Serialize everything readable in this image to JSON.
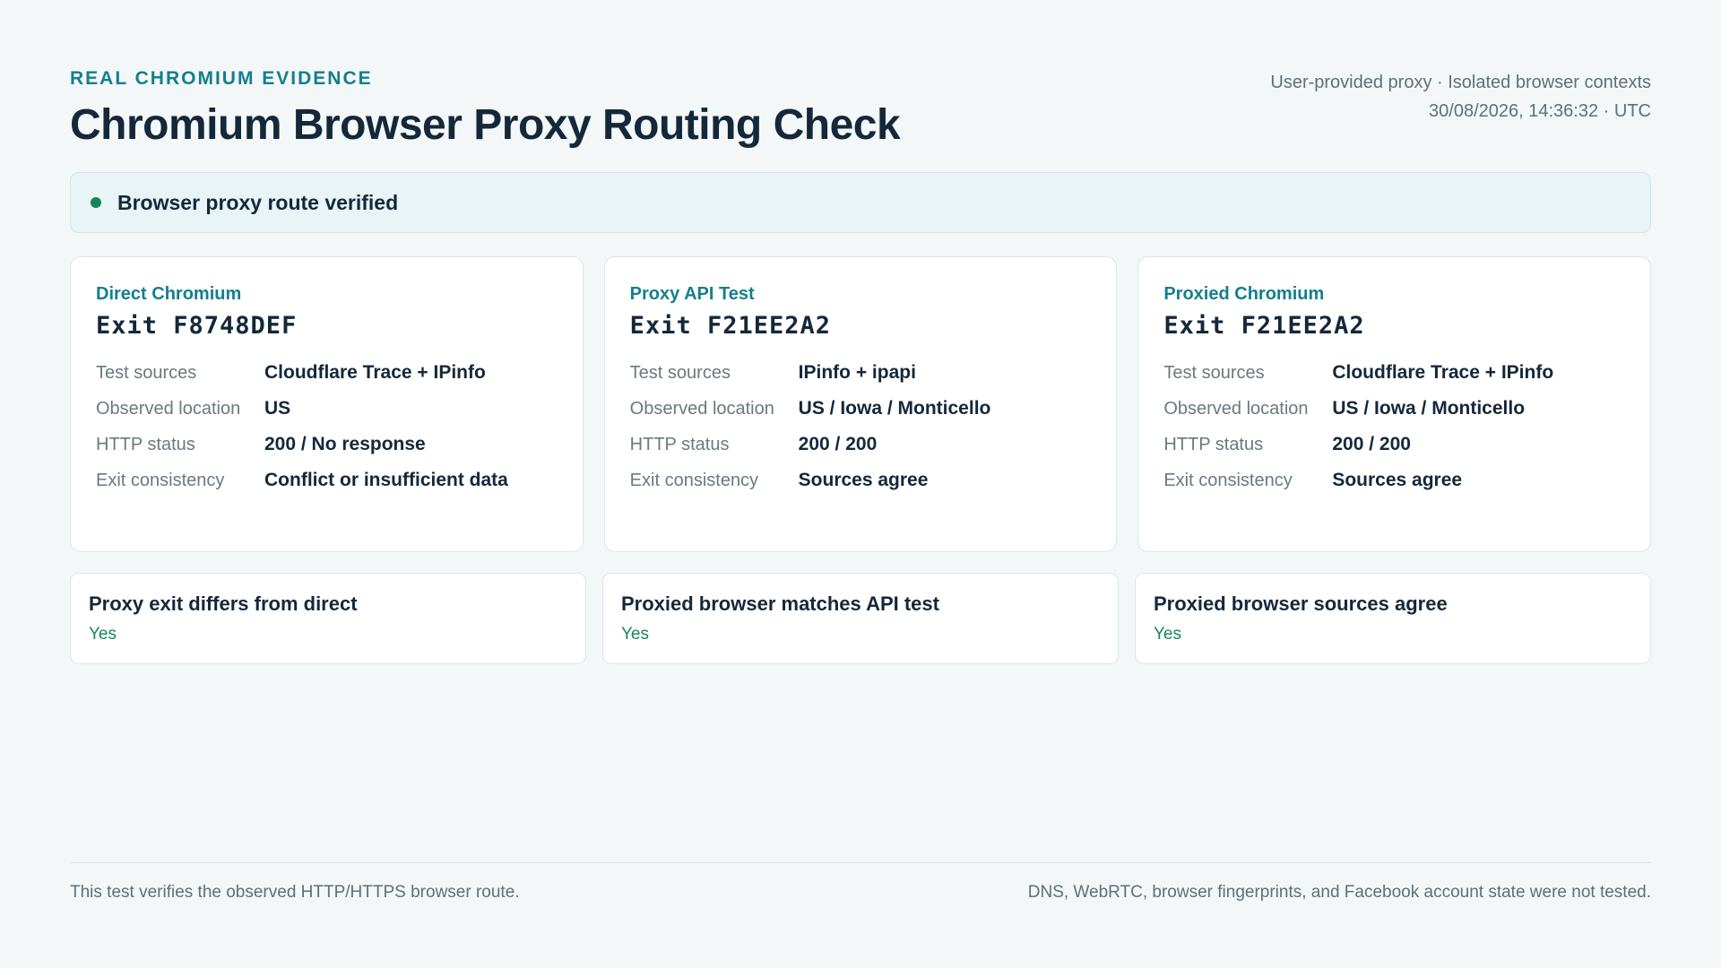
{
  "header": {
    "eyebrow": "REAL CHROMIUM EVIDENCE",
    "title": "Chromium Browser Proxy Routing Check",
    "meta_line1": "User-provided proxy · Isolated browser contexts",
    "meta_line2": "30/08/2026, 14:36:32 · UTC"
  },
  "banner": {
    "status_text": "Browser proxy route verified",
    "status_color": "#17855c"
  },
  "cards": [
    {
      "label": "Direct Chromium",
      "exit": "Exit F8748DEF",
      "rows": [
        {
          "key": "Test sources",
          "value": "Cloudflare Trace + IPinfo"
        },
        {
          "key": "Observed location",
          "value": "US"
        },
        {
          "key": "HTTP status",
          "value": "200 / No response"
        },
        {
          "key": "Exit consistency",
          "value": "Conflict or insufficient data"
        }
      ]
    },
    {
      "label": "Proxy API Test",
      "exit": "Exit F21EE2A2",
      "rows": [
        {
          "key": "Test sources",
          "value": "IPinfo + ipapi"
        },
        {
          "key": "Observed location",
          "value": "US / Iowa / Monticello"
        },
        {
          "key": "HTTP status",
          "value": "200 / 200"
        },
        {
          "key": "Exit consistency",
          "value": "Sources agree"
        }
      ]
    },
    {
      "label": "Proxied Chromium",
      "exit": "Exit F21EE2A2",
      "rows": [
        {
          "key": "Test sources",
          "value": "Cloudflare Trace + IPinfo"
        },
        {
          "key": "Observed location",
          "value": "US / Iowa / Monticello"
        },
        {
          "key": "HTTP status",
          "value": "200 / 200"
        },
        {
          "key": "Exit consistency",
          "value": "Sources agree"
        }
      ]
    }
  ],
  "checks": [
    {
      "question": "Proxy exit differs from direct",
      "answer": "Yes"
    },
    {
      "question": "Proxied browser matches API test",
      "answer": "Yes"
    },
    {
      "question": "Proxied browser sources agree",
      "answer": "Yes"
    }
  ],
  "footer": {
    "left": "This test verifies the observed HTTP/HTTPS browser route.",
    "right": "DNS, WebRTC, browser fingerprints, and Facebook account state were not tested."
  },
  "colors": {
    "accent": "#137f8d",
    "success": "#17855c",
    "text": "#14283a"
  }
}
